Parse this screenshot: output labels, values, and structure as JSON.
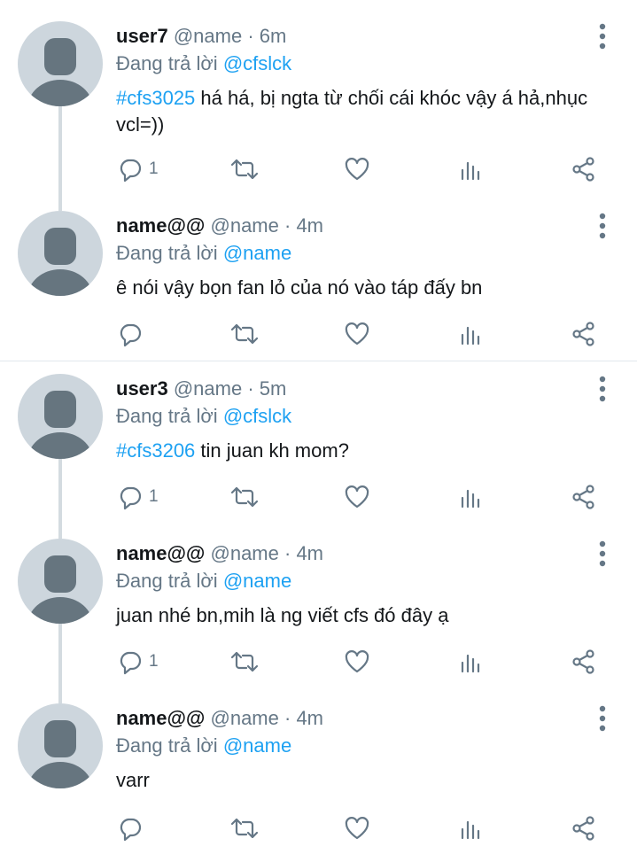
{
  "reply_prefix": "Đang trả lời",
  "tweets": [
    {
      "name": "user7",
      "handle": "@name",
      "time": "6m",
      "reply_to": "@cfslck",
      "hashtag": "#cfs3025",
      "text": " há há, bị ngta từ chối cái khóc vậy á hả,nhục vcl=))",
      "reply_count": "1"
    },
    {
      "name": "name@@",
      "handle": "@name",
      "time": "4m",
      "reply_to": "@name",
      "hashtag": "",
      "text": "ê nói vậy bọn fan lỏ của nó vào táp đấy bn",
      "reply_count": ""
    },
    {
      "name": "user3",
      "handle": "@name",
      "time": "5m",
      "reply_to": "@cfslck",
      "hashtag": "#cfs3206",
      "text": " tin juan kh mom?",
      "reply_count": "1"
    },
    {
      "name": "name@@",
      "handle": "@name",
      "time": "4m",
      "reply_to": "@name",
      "hashtag": "",
      "text": "juan nhé bn,mih là ng viết cfs đó đây ạ",
      "reply_count": "1"
    },
    {
      "name": "name@@",
      "handle": "@name",
      "time": "4m",
      "reply_to": "@name",
      "hashtag": "",
      "text": "varr",
      "reply_count": ""
    }
  ],
  "icons": {
    "more": "more-vertical-icon",
    "reply": "reply-icon",
    "retweet": "retweet-icon",
    "like": "heart-icon",
    "analytics": "analytics-icon",
    "share": "share-icon"
  },
  "colors": {
    "link": "#1da1f2",
    "secondary": "#657786",
    "avatar_bg": "#cdd6dd",
    "avatar_fg": "#66757f"
  }
}
